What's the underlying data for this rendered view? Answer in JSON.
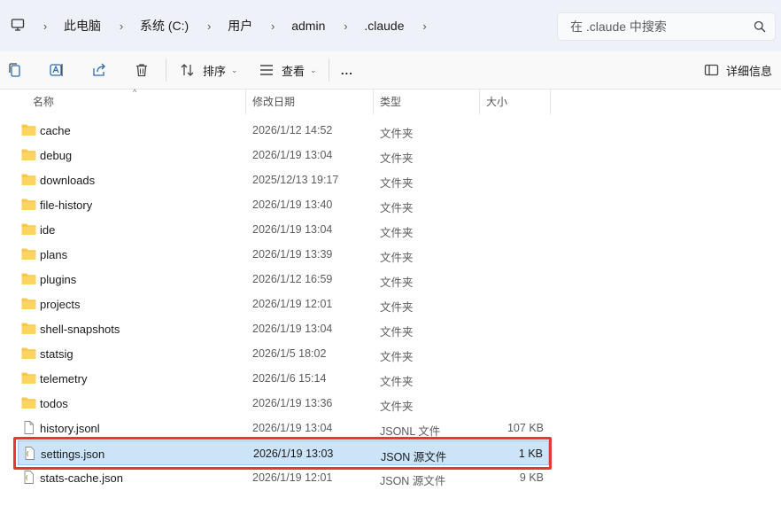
{
  "address_bar": {
    "crumbs": [
      "此电脑",
      "系统 (C:)",
      "用户",
      "admin",
      ".claude"
    ],
    "search_placeholder": "在 .claude 中搜索"
  },
  "toolbar": {
    "sort_label": "排序",
    "view_label": "查看",
    "more_label": "...",
    "details_label": "详细信息"
  },
  "columns": {
    "name": "名称",
    "date": "修改日期",
    "type": "类型",
    "size": "大小"
  },
  "files": [
    {
      "name": "cache",
      "date": "2026/1/12 14:52",
      "type": "文件夹",
      "size": "",
      "icon": "folder-icon"
    },
    {
      "name": "debug",
      "date": "2026/1/19 13:04",
      "type": "文件夹",
      "size": "",
      "icon": "folder-icon"
    },
    {
      "name": "downloads",
      "date": "2025/12/13 19:17",
      "type": "文件夹",
      "size": "",
      "icon": "folder-icon"
    },
    {
      "name": "file-history",
      "date": "2026/1/19 13:40",
      "type": "文件夹",
      "size": "",
      "icon": "folder-icon"
    },
    {
      "name": "ide",
      "date": "2026/1/19 13:04",
      "type": "文件夹",
      "size": "",
      "icon": "folder-icon"
    },
    {
      "name": "plans",
      "date": "2026/1/19 13:39",
      "type": "文件夹",
      "size": "",
      "icon": "folder-icon"
    },
    {
      "name": "plugins",
      "date": "2026/1/12 16:59",
      "type": "文件夹",
      "size": "",
      "icon": "folder-icon"
    },
    {
      "name": "projects",
      "date": "2026/1/19 12:01",
      "type": "文件夹",
      "size": "",
      "icon": "folder-icon"
    },
    {
      "name": "shell-snapshots",
      "date": "2026/1/19 13:04",
      "type": "文件夹",
      "size": "",
      "icon": "folder-icon"
    },
    {
      "name": "statsig",
      "date": "2026/1/5 18:02",
      "type": "文件夹",
      "size": "",
      "icon": "folder-icon"
    },
    {
      "name": "telemetry",
      "date": "2026/1/6 15:14",
      "type": "文件夹",
      "size": "",
      "icon": "folder-icon"
    },
    {
      "name": "todos",
      "date": "2026/1/19 13:36",
      "type": "文件夹",
      "size": "",
      "icon": "folder-icon"
    },
    {
      "name": "history.jsonl",
      "date": "2026/1/19 13:04",
      "type": "JSONL 文件",
      "size": "107 KB",
      "icon": "document-icon"
    },
    {
      "name": "settings.json",
      "date": "2026/1/19 13:03",
      "type": "JSON 源文件",
      "size": "1 KB",
      "icon": "json-file-icon"
    },
    {
      "name": "stats-cache.json",
      "date": "2026/1/19 12:01",
      "type": "JSON 源文件",
      "size": "9 KB",
      "icon": "json-file-icon"
    }
  ],
  "selected_file": "settings.json",
  "colors": {
    "selection_bg": "#cce4f7",
    "highlight_border": "#e53935",
    "folder": "#f8c94c"
  }
}
